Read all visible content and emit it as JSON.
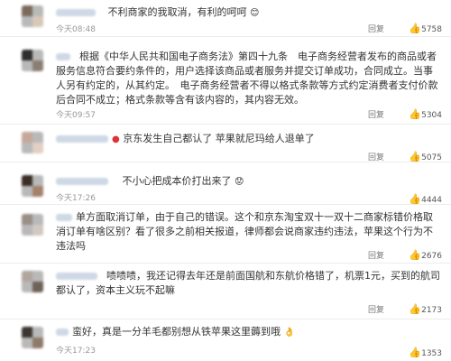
{
  "reply_label": "回复",
  "like_icon": "thumbs-up-icon",
  "comments": [
    {
      "text": "不利商家的我取消，有利的呵呵",
      "emoji": "😊",
      "time": "今天08:48",
      "likes": "5758"
    },
    {
      "text": "根据《中华人民共和国电子商务法》第四十九条　电子商务经营者发布的商品或者服务信息符合要约条件的，用户选择该商品或者服务并提交订单成功，合同成立。当事人另有约定的，从其约定。　电子商务经营者不得以格式条款等方式约定消费者支付价款后合同不成立；格式条款等含有该内容的，其内容无效。",
      "time": "今天09:57",
      "likes": "5304"
    },
    {
      "text": "京东发生自己都认了 苹果就尼玛给人退单了",
      "time": "",
      "likes": "5075"
    },
    {
      "text": "不小心把成本价打出来了",
      "emoji": "😟",
      "time": "今天17:26",
      "likes": "4444"
    },
    {
      "text": "单方面取消订单，由于自己的错误。这个和京东淘宝双十一双十二商家标错价格取消订单有啥区别？看了很多之前相关报道，律师都会说商家违约违法，苹果这个行为不违法吗",
      "time": "",
      "likes": "2676"
    },
    {
      "text": "啧啧啧，我还记得去年还是前面国航和东航价格错了，机票1元，买到的航司都认了，资本主义玩不起嘛",
      "time": "",
      "likes": "2173"
    },
    {
      "text": "蛮好，真是一分羊毛都别想从铁苹果这里薅到哦",
      "emoji": "👌",
      "time": "今天17:23",
      "likes": "1353"
    }
  ]
}
